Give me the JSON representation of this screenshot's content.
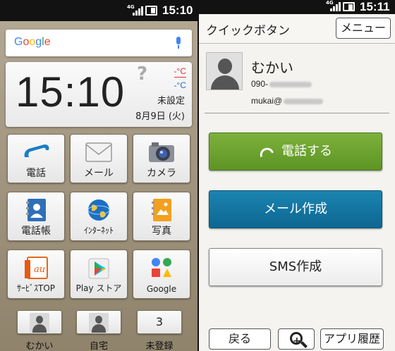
{
  "left_screen": {
    "status": {
      "network": "4G",
      "time": "15:10"
    },
    "search": {
      "logo": "Google"
    },
    "clock": {
      "time": "15:10",
      "weather_symbol": "?",
      "temp_high": "-°C",
      "temp_low": "-°C",
      "location_status": "未設定",
      "date": "8月9日 (火)"
    },
    "apps": [
      {
        "label": "電話",
        "icon": "phone-icon"
      },
      {
        "label": "メール",
        "icon": "mail-icon"
      },
      {
        "label": "カメラ",
        "icon": "camera-icon"
      },
      {
        "label": "電話帳",
        "icon": "contacts-icon"
      },
      {
        "label": "ｲﾝﾀｰﾈｯﾄ",
        "icon": "globe-icon"
      },
      {
        "label": "写真",
        "icon": "photo-icon"
      },
      {
        "label": "ｻｰﾋﾞｽTOP",
        "icon": "au-icon",
        "icon_text": "au"
      },
      {
        "label": "Play ストア",
        "icon": "play-store-icon"
      },
      {
        "label": "Google",
        "icon": "google-apps-icon"
      }
    ],
    "quick_contacts": [
      {
        "label": "むかい",
        "type": "person"
      },
      {
        "label": "自宅",
        "type": "person"
      },
      {
        "label": "未登録",
        "type": "number",
        "number": "3"
      }
    ]
  },
  "right_screen": {
    "status": {
      "network": "4G",
      "time": "15:11"
    },
    "header": {
      "title": "クイックボタン",
      "menu_label": "メニュー"
    },
    "contact": {
      "name": "むかい",
      "phone_prefix": "090-",
      "email_prefix": "mukai@"
    },
    "actions": {
      "call_label": "電話する",
      "mail_label": "メール作成",
      "sms_label": "SMS作成"
    },
    "footer": {
      "back_label": "戻る",
      "history_label": "アプリ履歴"
    }
  },
  "colors": {
    "call_green": "#6aa22e",
    "mail_blue": "#1178a3",
    "temp_high": "#dd3333",
    "temp_low": "#2a6bc2"
  }
}
